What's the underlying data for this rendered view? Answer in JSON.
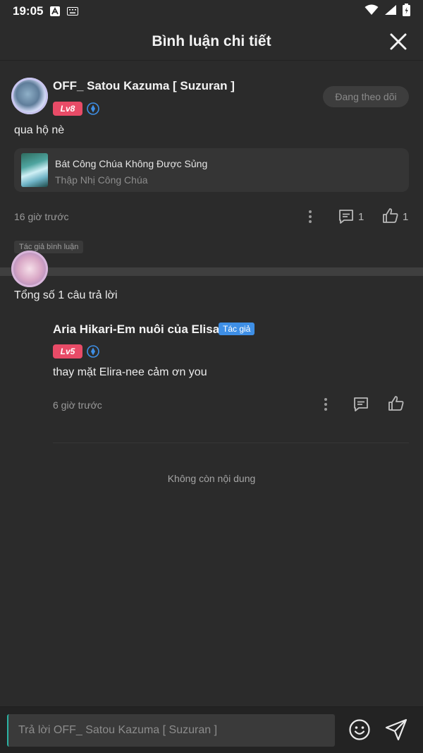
{
  "status_bar": {
    "time": "19:05"
  },
  "header": {
    "title": "Bình luận chi tiết"
  },
  "comment": {
    "username": "OFF_ Satou Kazuma [ Suzuran ]",
    "level": "Lv8",
    "follow_label": "Đang theo dõi",
    "text": "qua hộ nè",
    "book": {
      "title": "Bát Công Chúa Không Được Sủng",
      "subtitle": "Thập Nhị Công Chúa"
    },
    "time": "16 giờ trước",
    "reply_count": "1",
    "like_count": "1",
    "tag": "Tác giả bình luận"
  },
  "replies_total": "Tổng số 1 câu trả lời",
  "reply": {
    "username": "Aria Hikari-Em nuôi của Elisa",
    "author_tag": "Tác giả",
    "level": "Lv5",
    "text": "thay mặt Elira-nee cảm ơn you",
    "time": "6 giờ trước"
  },
  "end_text": "Không còn nội dung",
  "input": {
    "placeholder": "Trả lời OFF_ Satou Kazuma [ Suzuran ]"
  },
  "colors": {
    "background": "#2b2b2b",
    "level_badge": "#e84b67",
    "author_tag": "#3e8fe6",
    "verified": "#3e8fe6"
  }
}
